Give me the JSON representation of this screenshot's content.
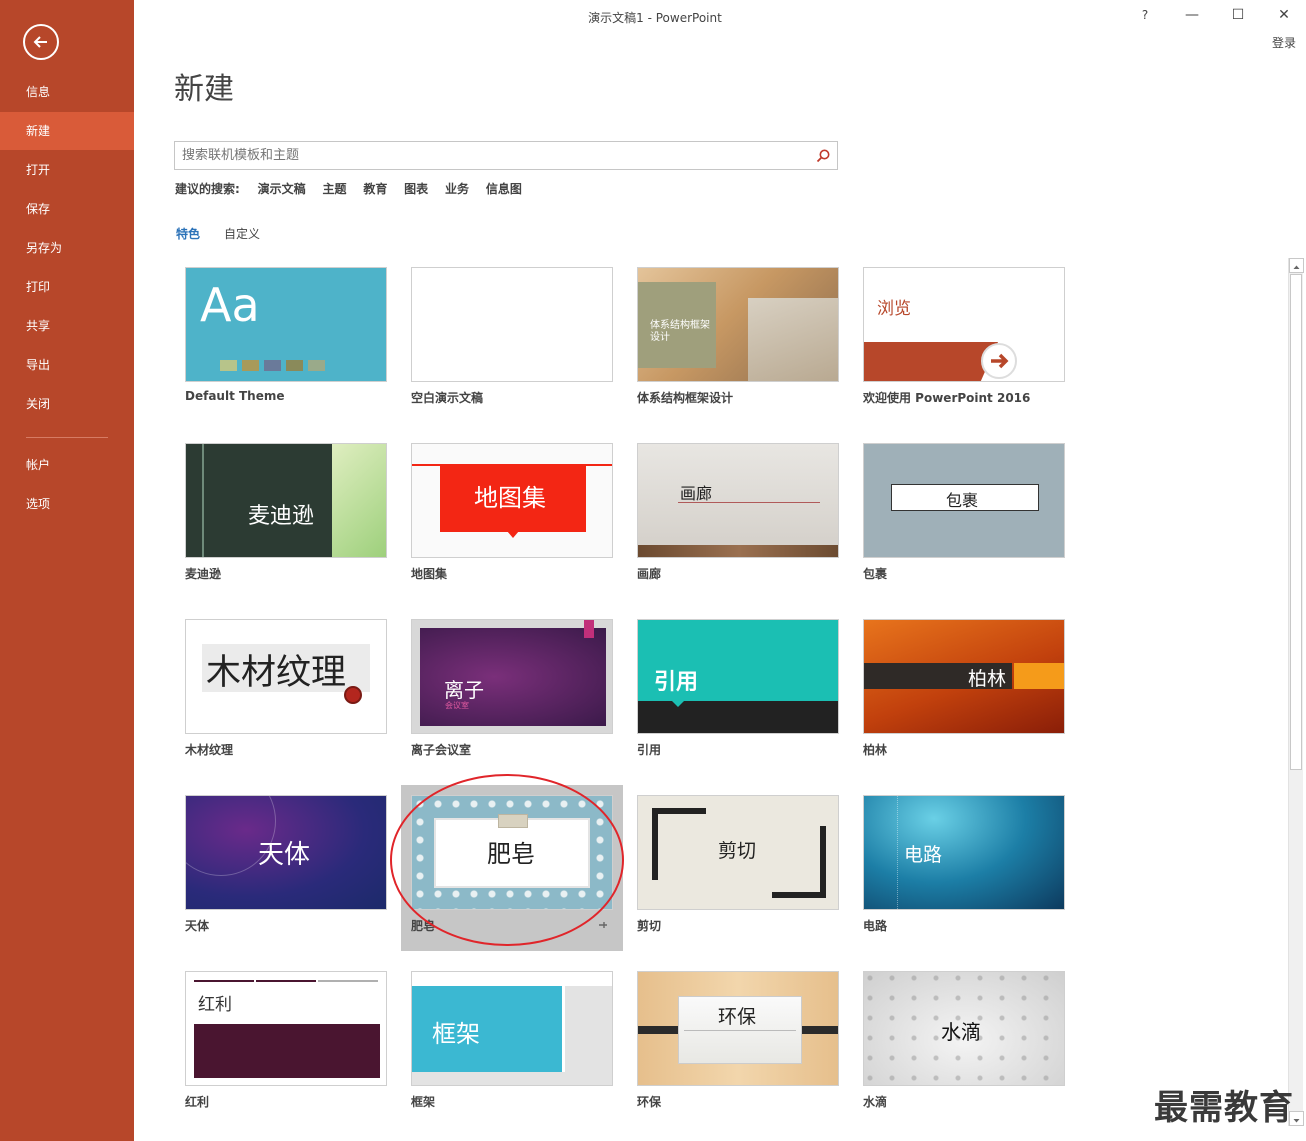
{
  "window": {
    "title": "演示文稿1 - PowerPoint",
    "help": "?",
    "minimize": "—",
    "maximize": "☐",
    "close": "✕",
    "login": "登录"
  },
  "sidebar": {
    "items": [
      "信息",
      "新建",
      "打开",
      "保存",
      "另存为",
      "打印",
      "共享",
      "导出",
      "关闭"
    ],
    "bottom_items": [
      "帐户",
      "选项"
    ],
    "active": "新建"
  },
  "main": {
    "title": "新建",
    "search": {
      "placeholder": "搜索联机模板和主题",
      "value": ""
    },
    "suggested": {
      "label": "建议的搜索:",
      "items": [
        "演示文稿",
        "主题",
        "教育",
        "图表",
        "业务",
        "信息图"
      ]
    },
    "tabs": [
      "特色",
      "自定义"
    ]
  },
  "templates": [
    {
      "label": "Default Theme",
      "thumb_text": "Aa",
      "colors": [
        "#4eb3c9",
        "#b7c48a",
        "#a89a5a",
        "#6a7a9a",
        "#8a8a5a",
        "#9aaa8a"
      ]
    },
    {
      "label": "空白演示文稿",
      "thumb_text": ""
    },
    {
      "label": "体系结构框架设计",
      "thumb_text": "体系结构框架设计"
    },
    {
      "label": "欢迎使用 PowerPoint 2016",
      "thumb_text": "浏览"
    },
    {
      "label": "麦迪逊",
      "thumb_text": "麦迪逊"
    },
    {
      "label": "地图集",
      "thumb_text": "地图集"
    },
    {
      "label": "画廊",
      "thumb_text": "画廊"
    },
    {
      "label": "包裹",
      "thumb_text": "包裹"
    },
    {
      "label": "木材纹理",
      "thumb_text": "木材纹理"
    },
    {
      "label": "离子会议室",
      "thumb_text": "离子",
      "sub_text": "会议室"
    },
    {
      "label": "引用",
      "thumb_text": "引用"
    },
    {
      "label": "柏林",
      "thumb_text": "柏林"
    },
    {
      "label": "天体",
      "thumb_text": "天体"
    },
    {
      "label": "肥皂",
      "thumb_text": "肥皂",
      "selected": true
    },
    {
      "label": "剪切",
      "thumb_text": "剪切"
    },
    {
      "label": "电路",
      "thumb_text": "电路"
    },
    {
      "label": "红利",
      "thumb_text": "红利"
    },
    {
      "label": "框架",
      "thumb_text": "框架"
    },
    {
      "label": "环保",
      "thumb_text": "环保"
    },
    {
      "label": "水滴",
      "thumb_text": "水滴"
    }
  ],
  "watermark": "最需教育",
  "colors": {
    "sidebar": "#b7472a",
    "sidebar_active": "#d95b39",
    "accent_blue": "#2b72b8",
    "annotation": "#e0252a"
  }
}
